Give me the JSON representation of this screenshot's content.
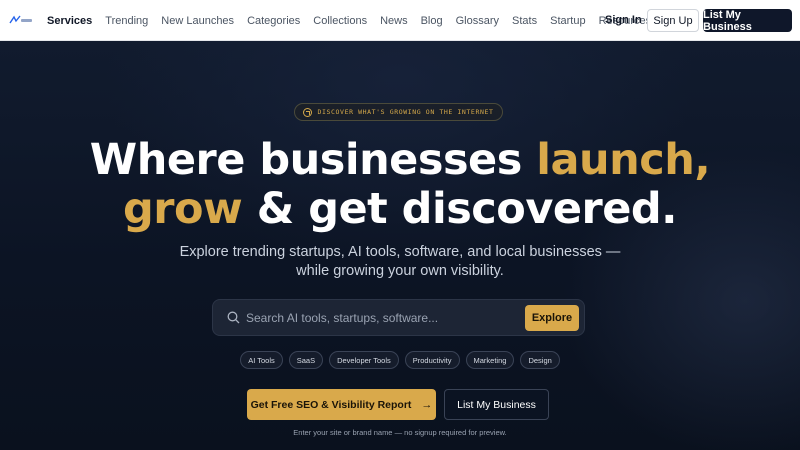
{
  "nav": {
    "links": [
      "Services",
      "Trending",
      "New Launches",
      "Categories",
      "Collections",
      "News",
      "Blog",
      "Glossary",
      "Stats",
      "Startup",
      "Resources"
    ],
    "signin": "Sign In",
    "signup": "Sign Up",
    "list_business": "List My Business"
  },
  "hero": {
    "badge": "DISCOVER WHAT'S GROWING ON THE INTERNET",
    "headline_1_white": "Where businesses",
    "headline_1_gold": "launch,",
    "headline_2_gold": "grow",
    "headline_2_white": "& get discovered.",
    "sub_1": "Explore trending startups, AI tools, software, and local businesses —",
    "sub_2": "while growing your own visibility.",
    "search_placeholder": "Search AI tools, startups, software...",
    "explore": "Explore",
    "chips": [
      "AI Tools",
      "SaaS",
      "Developer Tools",
      "Productivity",
      "Marketing",
      "Design"
    ],
    "cta_primary": "Get Free SEO & Visibility Report",
    "cta_arrow": "→",
    "cta_secondary": "List My Business",
    "note": "Enter your site or brand name — no signup required for preview."
  },
  "colors": {
    "accent": "#d9a94b",
    "nav_bg": "#ffffff",
    "hero_bg": "#0b1220"
  }
}
